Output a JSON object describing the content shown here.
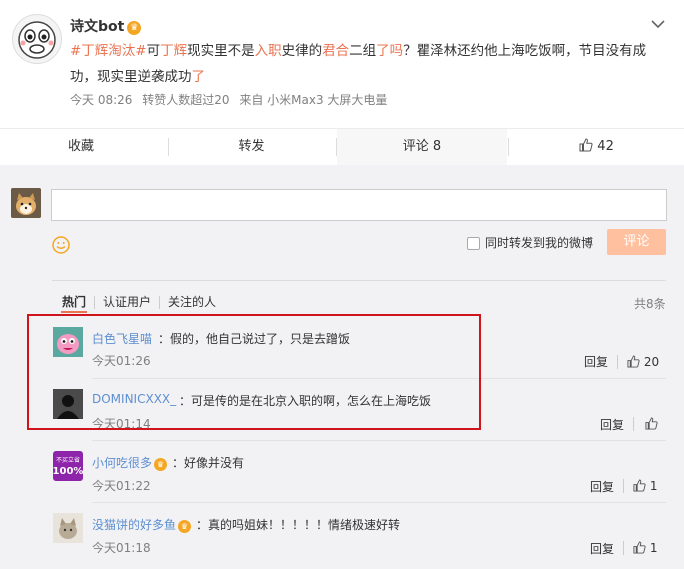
{
  "post": {
    "username": "诗文bot",
    "content_segments": [
      {
        "text": "#丁辉淘汰#",
        "type": "link"
      },
      {
        "text": "可",
        "type": "text"
      },
      {
        "text": "丁辉",
        "type": "link"
      },
      {
        "text": "现实里不是",
        "type": "text"
      },
      {
        "text": "入职",
        "type": "link"
      },
      {
        "text": "史律的",
        "type": "text"
      },
      {
        "text": "君合",
        "type": "link"
      },
      {
        "text": "二组",
        "type": "text"
      },
      {
        "text": "了吗",
        "type": "link"
      },
      {
        "text": "？瞿泽林还约他上海吃饭啊，节目没有成功，现实里逆袭成功",
        "type": "text"
      },
      {
        "text": "了",
        "type": "link"
      }
    ],
    "meta_time": "今天 08:26",
    "meta_reposts": "转赞人数超过20",
    "meta_source": "来自 小米Max3 大屏大电量"
  },
  "actions": {
    "favorite": "收藏",
    "repost": "转发",
    "comment": "评论 8",
    "like_count": "42"
  },
  "composer": {
    "checkbox_label": "同时转发到我的微博",
    "submit_label": "评论"
  },
  "filter_tabs": [
    "热门",
    "认证用户",
    "关注的人"
  ],
  "total_count": "共8条",
  "comments": [
    {
      "name": "白色飞星喵",
      "text": "：假的，他自己说过了，只是去蹭饭",
      "time": "今天01:26",
      "reply": "回复",
      "likes": "20"
    },
    {
      "name": "DOMINICXXX_",
      "text": "：可是传的是在北京入职的啊，怎么在上海吃饭",
      "time": "今天01:14",
      "reply": "回复",
      "likes": ""
    },
    {
      "name": "小何吃很多",
      "text": "：好像并没有",
      "time": "今天01:22",
      "reply": "回复",
      "likes": "1"
    },
    {
      "name": "没猫饼的好多鱼",
      "text": "：真的吗姐妹！！！！！情绪极速好转",
      "time": "今天01:18",
      "reply": "回复",
      "likes": "1"
    }
  ],
  "avatar_text": "不买立省 100%",
  "colors": {
    "link": "#eb7350",
    "name": "#5d8fd0",
    "highlight": "#d0141b",
    "button": "#ffc09f"
  }
}
